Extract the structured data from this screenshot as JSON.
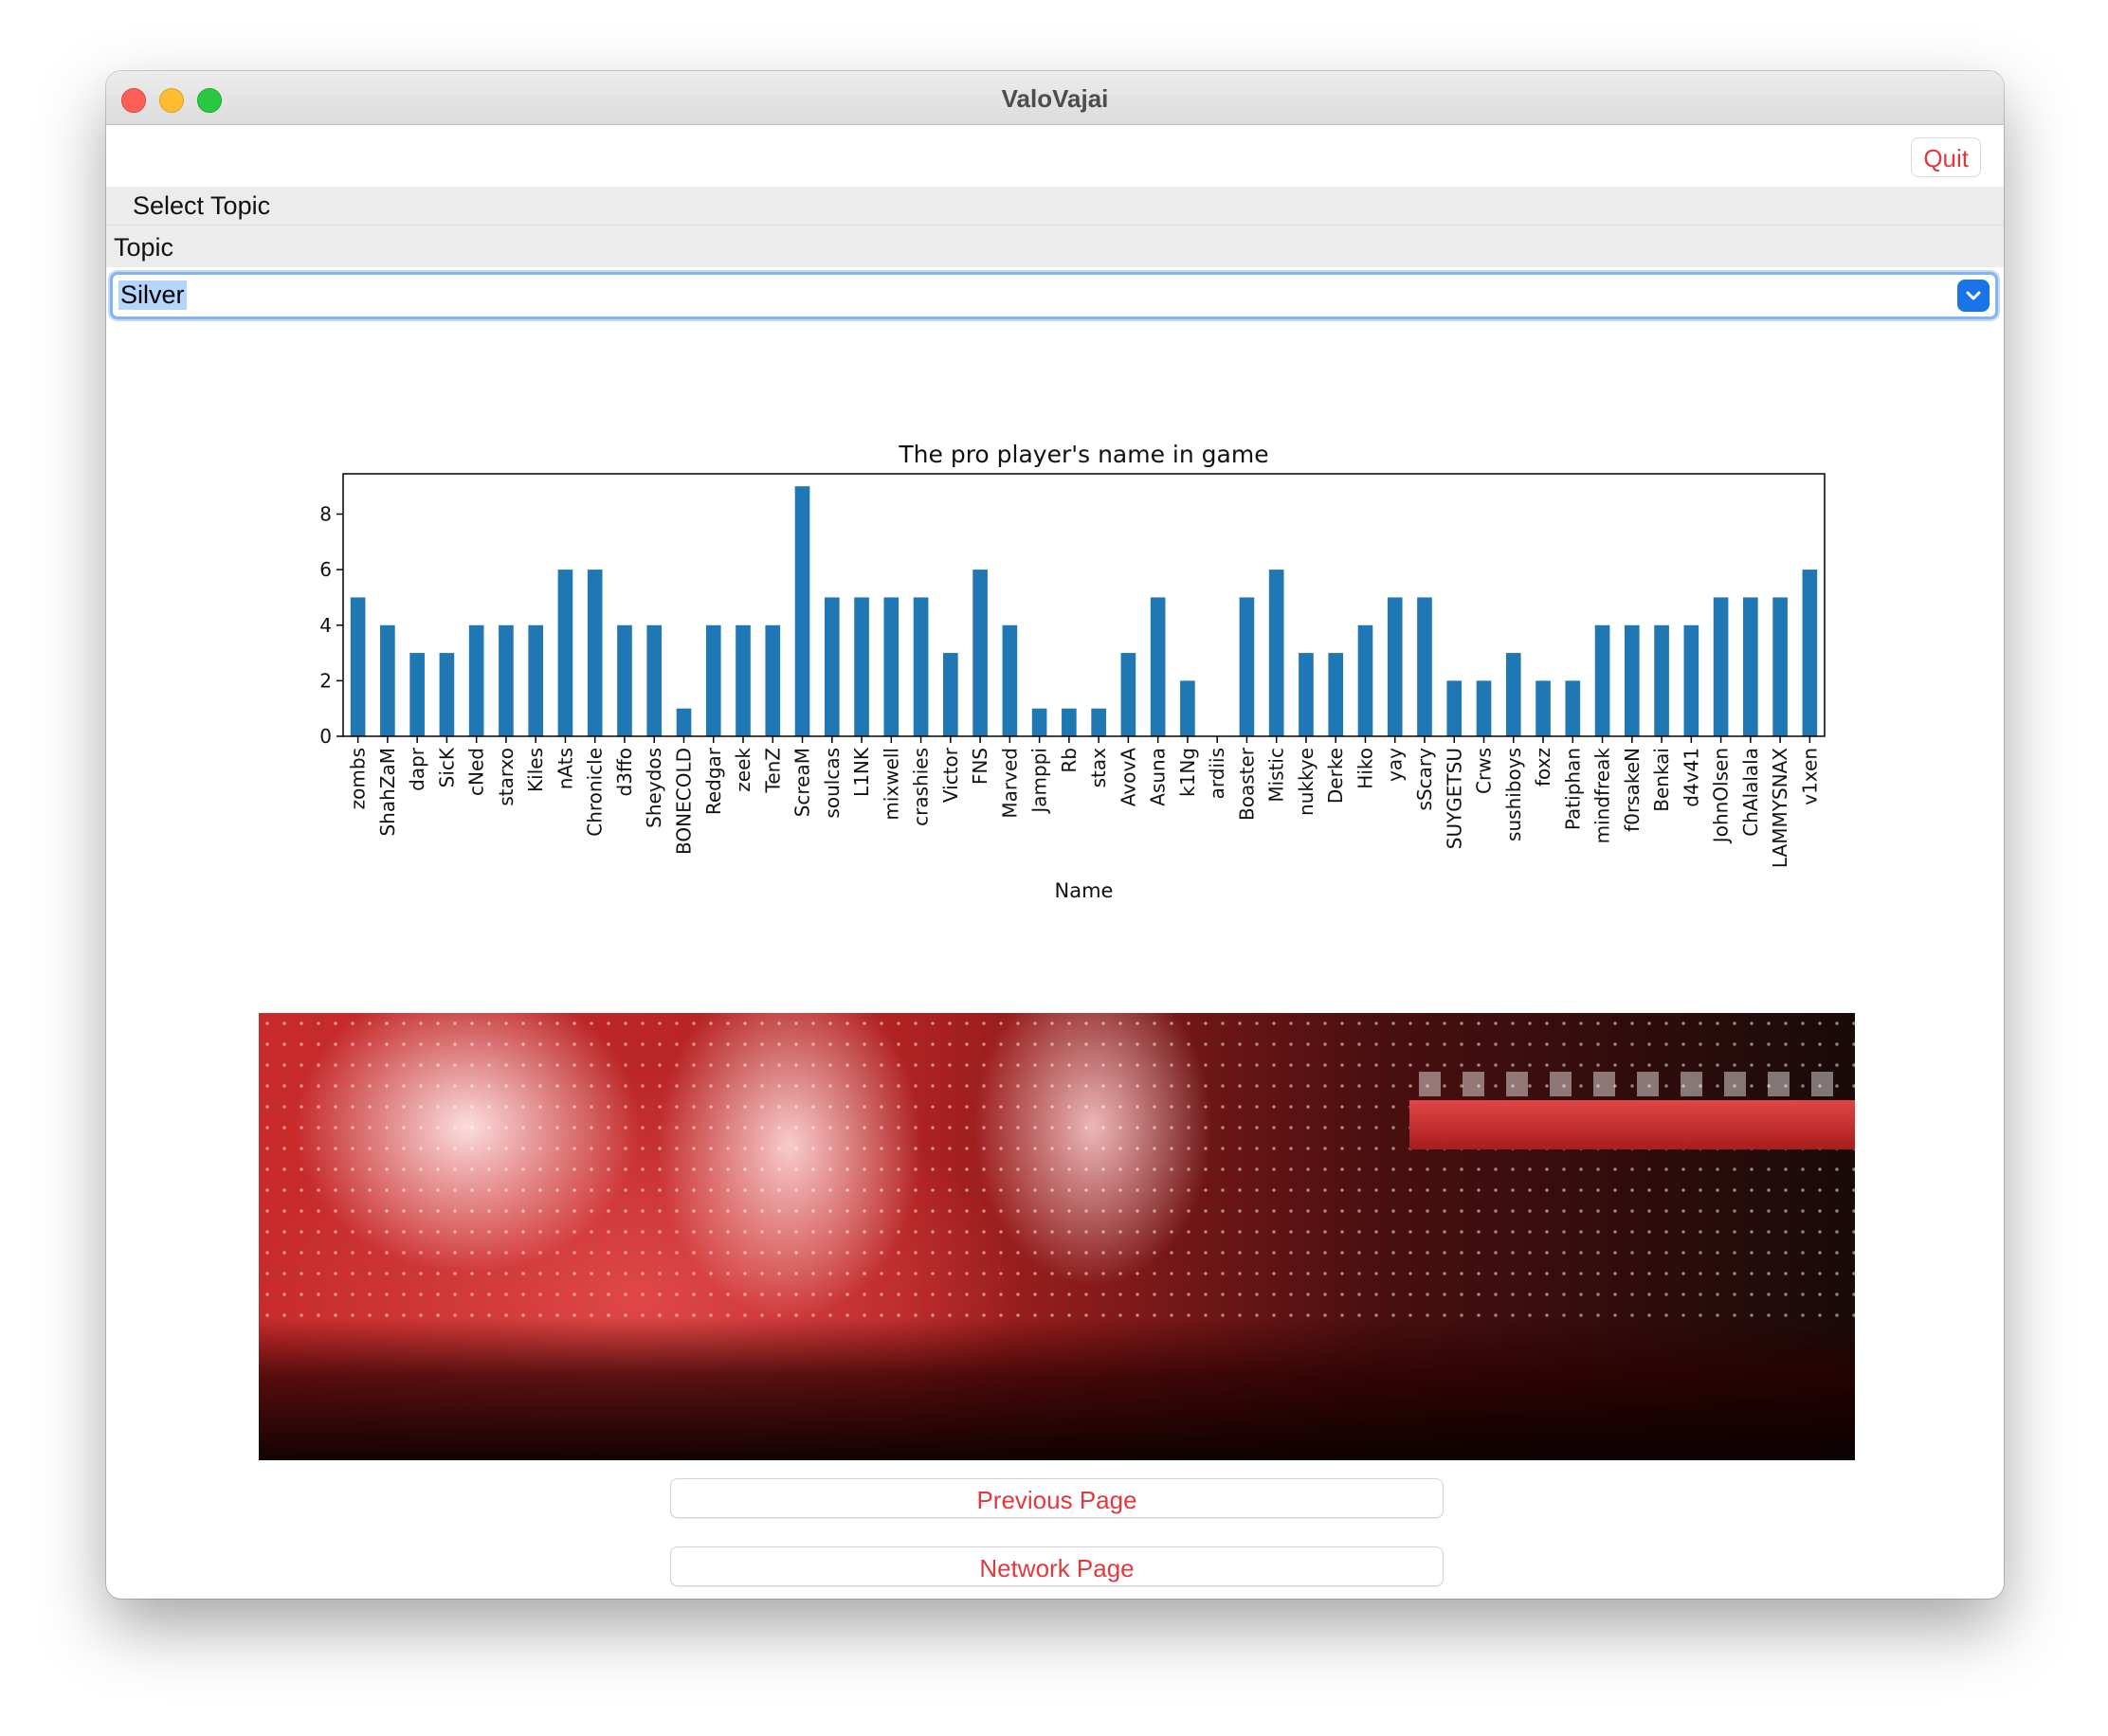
{
  "window": {
    "title": "ValoVajai"
  },
  "toolbar": {
    "quit_label": "Quit"
  },
  "section": {
    "header": "Select Topic"
  },
  "topic": {
    "label": "Topic",
    "selected": "Silver"
  },
  "buttons": {
    "previous": "Previous Page",
    "network": "Network Page"
  },
  "colors": {
    "bar": "#1f77b4",
    "accent": "#e0393e",
    "focus": "#83b3f0"
  },
  "banner": {
    "description_icon": "esports-arena-image"
  },
  "chart_data": {
    "type": "bar",
    "title": "The pro player's name in game",
    "xlabel": "Name",
    "ylabel": "",
    "ylim": [
      0,
      9.45
    ],
    "yticks": [
      0,
      2,
      4,
      6,
      8
    ],
    "categories": [
      "zombs",
      "ShahZaM",
      "dapr",
      "SicK",
      "cNed",
      "starxo",
      "Kiles",
      "nAts",
      "Chronicle",
      "d3ffo",
      "Sheydos",
      "BONECOLD",
      "Redgar",
      "zeek",
      "TenZ",
      "ScreaM",
      "soulcas",
      "L1NK",
      "mixwell",
      "crashies",
      "Victor",
      "FNS",
      "Marved",
      "Jamppi",
      "Rb",
      "stax",
      "AvovA",
      "Asuna",
      "k1Ng",
      "ardiis",
      "Boaster",
      "Mistic",
      "nukkye",
      "Derke",
      "Hiko",
      "yay",
      "sScary",
      "SUYGETSU",
      "Crws",
      "sushiboys",
      "foxz",
      "Patiphan",
      "mindfreak",
      "f0rsakeN",
      "Benkai",
      "d4v41",
      "JohnOlsen",
      "ChAlalala",
      "LAMMYSNAX",
      "v1xen"
    ],
    "values": [
      5,
      4,
      3,
      3,
      4,
      4,
      4,
      6,
      6,
      4,
      4,
      1,
      4,
      4,
      4,
      9,
      5,
      5,
      5,
      5,
      3,
      6,
      4,
      1,
      1,
      1,
      3,
      5,
      2,
      0,
      5,
      6,
      3,
      3,
      4,
      5,
      5,
      2,
      2,
      3,
      2,
      2,
      4,
      4,
      4,
      4,
      5,
      5,
      5,
      6
    ],
    "grid": false,
    "legend": "none"
  }
}
